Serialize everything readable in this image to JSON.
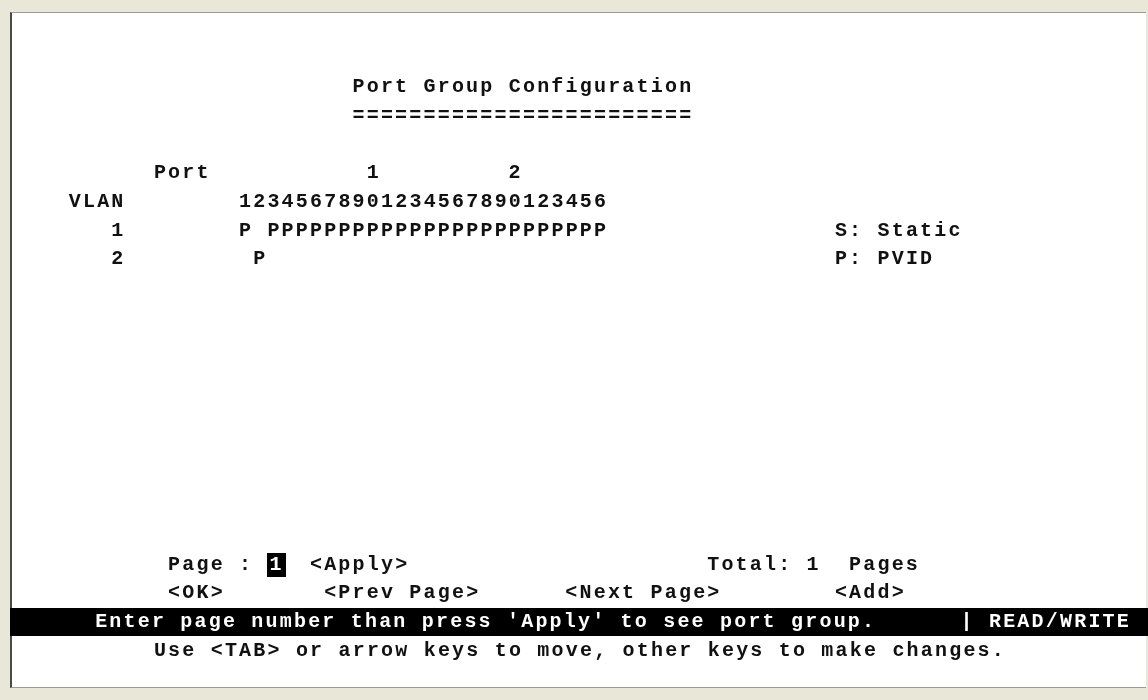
{
  "title": "Port Group Configuration",
  "title_underline": "========================",
  "table": {
    "port_label": "Port",
    "vlan_label": "VLAN",
    "port_tens": [
      "1",
      "2"
    ],
    "port_digits": "12345678901234567890123456",
    "rows": [
      {
        "vlan": "1",
        "members": "P PPPPPPPPPPPPPPPPPPPPPPPP"
      },
      {
        "vlan": "2",
        "members": " P"
      }
    ]
  },
  "legend": [
    "S: Static",
    "P: PVID"
  ],
  "page_field": {
    "label": "Page :",
    "value": "1"
  },
  "apply_button": "<Apply>",
  "total": {
    "label": "Total:",
    "value": "1",
    "unit": "Pages"
  },
  "buttons": [
    "<OK>",
    "<Prev Page>",
    "<Next Page>",
    "<Add>"
  ],
  "status_bar": {
    "message": "Enter page number than press 'Apply' to see port group.",
    "mode": "| READ/WRITE"
  },
  "help_line": "Use <TAB> or arrow keys to move, other keys to make changes."
}
